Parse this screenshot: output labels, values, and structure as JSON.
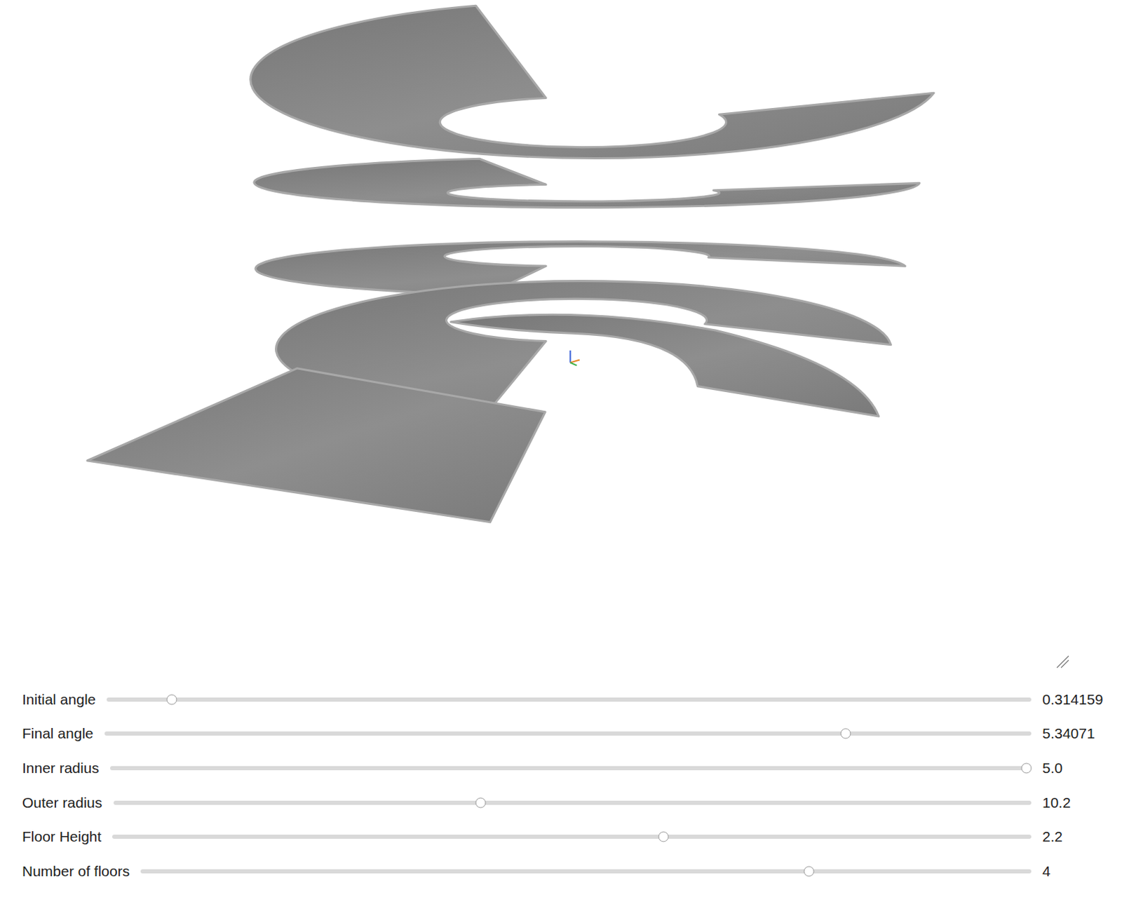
{
  "viewer": {
    "name": "spiral-staircase-3d"
  },
  "sliders": [
    {
      "label": "Initial angle",
      "value": "0.314159",
      "level": 0.07
    },
    {
      "label": "Final angle",
      "value": "5.34071",
      "level": 0.8
    },
    {
      "label": "Inner radius",
      "value": "5.0",
      "level": 0.995
    },
    {
      "label": "Outer radius",
      "value": "10.2",
      "level": 0.4
    },
    {
      "label": "Floor Height",
      "value": "2.2",
      "level": 0.6
    },
    {
      "label": "Number of floors",
      "value": "4",
      "level": 0.75
    }
  ]
}
